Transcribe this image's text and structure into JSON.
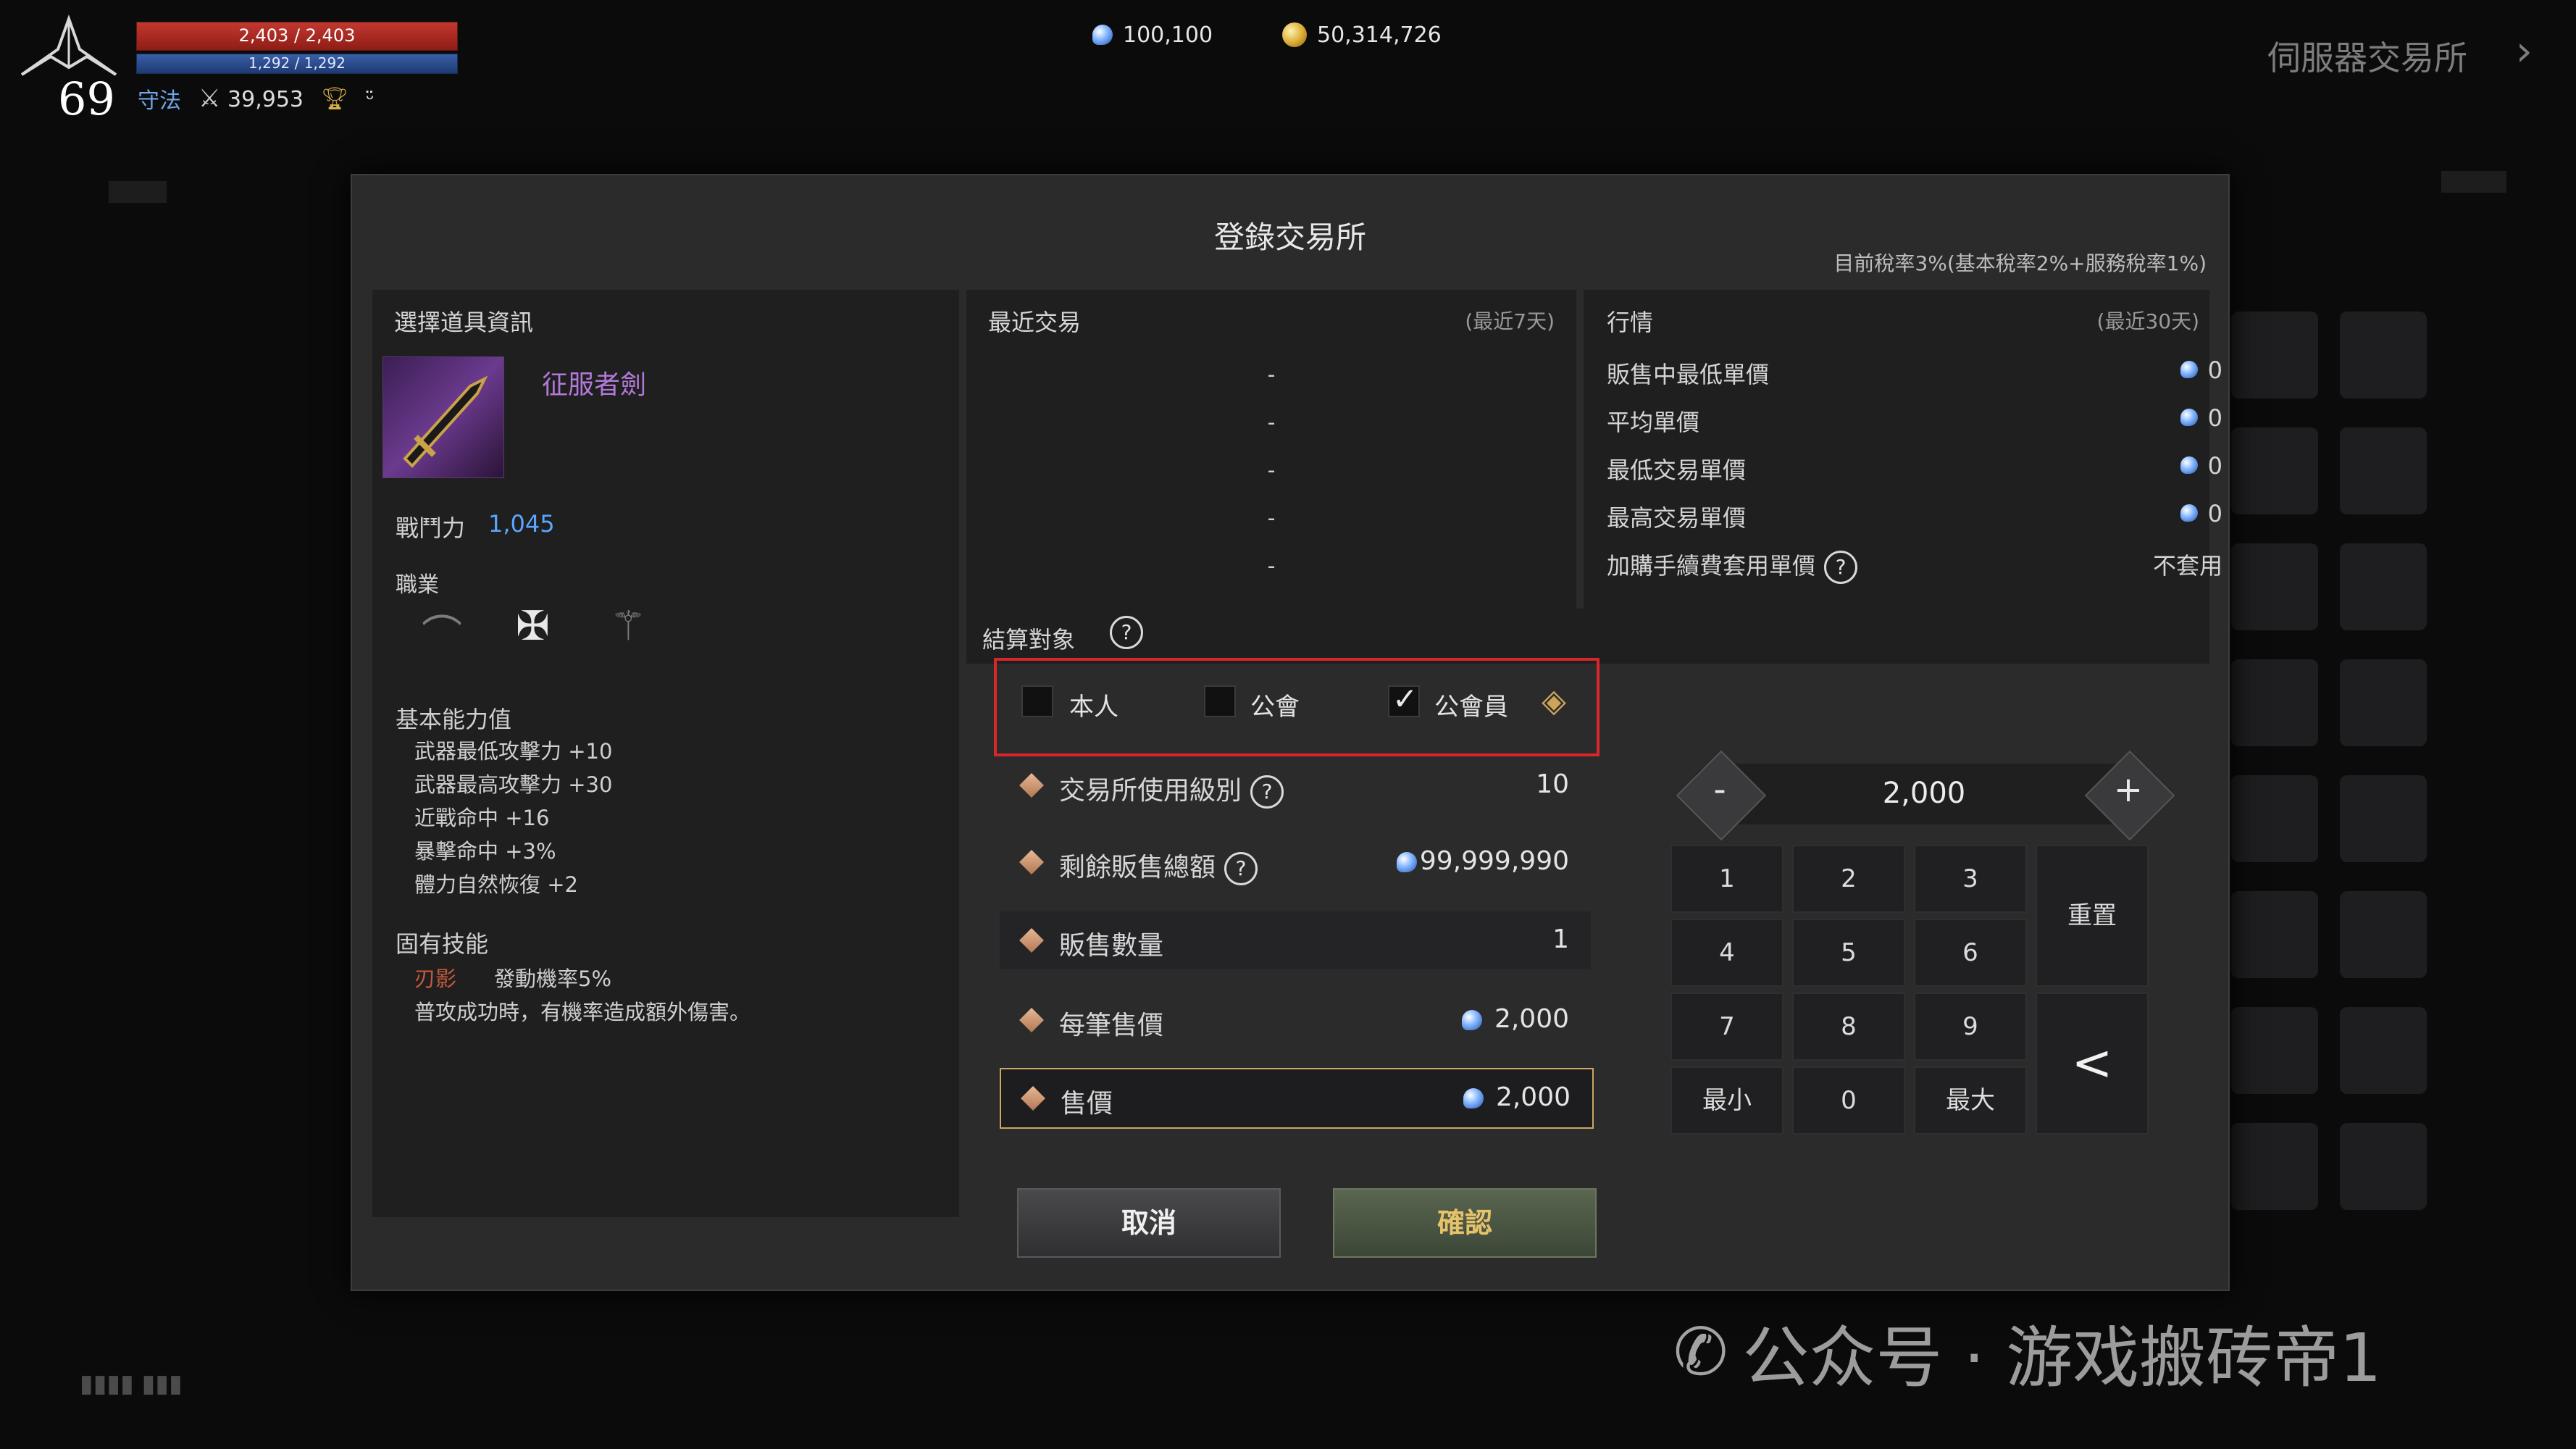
{
  "hud": {
    "hp": "2,403 / 2,403",
    "mp": "1,292 / 1,292",
    "level": "69",
    "class_name": "守法",
    "combat_power": "39,953"
  },
  "currency": {
    "gems": "100,100",
    "gold": "50,314,726"
  },
  "server_title": "伺服器交易所",
  "dialog": {
    "title": "登錄交易所",
    "tax_note": "目前稅率3%(基本稅率2%+服務稅率1%)",
    "item_panel": {
      "header": "選擇道具資訊",
      "item_name": "征服者劍",
      "combat_label": "戰鬥力",
      "combat_value": "1,045",
      "job_label": "職業",
      "base_stats_label": "基本能力值",
      "base_stats": [
        "武器最低攻擊力 +10",
        "武器最高攻擊力 +30",
        "近戰命中 +16",
        "暴擊命中 +3%",
        "體力自然恢復 +2"
      ],
      "skill_label": "固有技能",
      "skill_name": "刃影",
      "skill_chance": "發動機率5%",
      "skill_desc": "普攻成功時，有機率造成額外傷害。"
    },
    "recent": {
      "header": "最近交易",
      "period": "(最近7天)",
      "rows": [
        "-",
        "-",
        "-",
        "-",
        "-"
      ]
    },
    "market": {
      "header": "行情",
      "period": "(最近30天)",
      "rows": [
        {
          "label": "販售中最低單價",
          "value": "0"
        },
        {
          "label": "平均單價",
          "value": "0"
        },
        {
          "label": "最低交易單價",
          "value": "0"
        },
        {
          "label": "最高交易單價",
          "value": "0"
        }
      ],
      "fee_label": "加購手續費套用單價",
      "fee_value": "不套用"
    },
    "settle": {
      "label": "結算對象",
      "options": [
        {
          "label": "本人",
          "checked": false
        },
        {
          "label": "公會",
          "checked": false
        },
        {
          "label": "公會員",
          "checked": true
        }
      ]
    },
    "form": {
      "level_label": "交易所使用級別",
      "level_value": "10",
      "remaining_label": "剩餘販售總額",
      "remaining_value": "99,999,990",
      "qty_label": "販售數量",
      "qty_value": "1",
      "unit_label": "每筆售價",
      "unit_value": "2,000",
      "price_label": "售價",
      "price_value": "2,000"
    },
    "numpad": {
      "display": "2,000",
      "minus": "-",
      "plus": "+",
      "keys": [
        "1",
        "2",
        "3",
        "4",
        "5",
        "6",
        "7",
        "8",
        "9"
      ],
      "min": "最小",
      "zero": "0",
      "max": "最大",
      "reset": "重置",
      "back": "<"
    },
    "buttons": {
      "cancel": "取消",
      "confirm": "確認"
    }
  },
  "watermark": "公众号 · 游戏搬砖帝1",
  "colors": {
    "hp": "#c2382f",
    "mp": "#3a5fa8",
    "highlight_box": "#d8262a",
    "item_name": "#b27ad8",
    "combat_value": "#5aa6ff",
    "confirm_text": "#e6c36a"
  }
}
